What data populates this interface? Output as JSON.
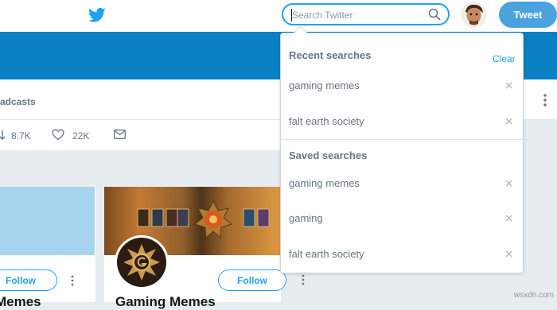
{
  "search": {
    "placeholder": "Search Twitter"
  },
  "header": {
    "tweet_label": "Tweet"
  },
  "profile_nav": {
    "label": "adcasts"
  },
  "stats": {
    "retweets": "8.7K",
    "likes": "22K"
  },
  "cards": [
    {
      "follow_label": "Follow",
      "title": "Memes"
    },
    {
      "follow_label": "Follow",
      "title": "Gaming Memes"
    }
  ],
  "dropdown": {
    "recent_heading": "Recent searches",
    "clear_label": "Clear",
    "recent": [
      "gaming memes",
      "falt earth society"
    ],
    "saved_heading": "Saved searches",
    "saved": [
      "gaming memes",
      "gaming",
      "falt earth society"
    ]
  },
  "watermark": "wsxdn.com",
  "colors": {
    "accent": "#1da1f2",
    "banner": "#0a80c4",
    "tweet_button": "#4aa3df"
  }
}
